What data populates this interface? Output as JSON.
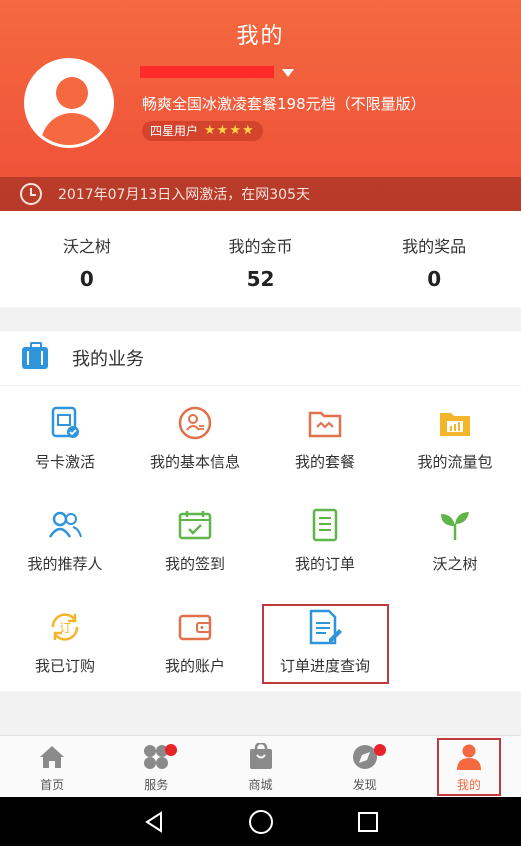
{
  "header": {
    "title": "我的",
    "plan": "畅爽全国冰激凌套餐198元档（不限量版）",
    "level": "四星用户",
    "stars": "★★★★",
    "activation": "2017年07月13日入网激活，在网305天"
  },
  "stats": [
    {
      "label": "沃之树",
      "value": "0"
    },
    {
      "label": "我的金币",
      "value": "52"
    },
    {
      "label": "我的奖品",
      "value": "0"
    }
  ],
  "services": {
    "title": "我的业务",
    "items": [
      {
        "label": "号卡激活",
        "icon": "sim-card-icon"
      },
      {
        "label": "我的基本信息",
        "icon": "profile-info-icon"
      },
      {
        "label": "我的套餐",
        "icon": "package-icon"
      },
      {
        "label": "我的流量包",
        "icon": "data-pack-icon"
      },
      {
        "label": "我的推荐人",
        "icon": "referrer-icon"
      },
      {
        "label": "我的签到",
        "icon": "check-in-icon"
      },
      {
        "label": "我的订单",
        "icon": "order-icon"
      },
      {
        "label": "沃之树",
        "icon": "tree-icon"
      },
      {
        "label": "我已订购",
        "icon": "subscribed-icon"
      },
      {
        "label": "我的账户",
        "icon": "wallet-icon"
      },
      {
        "label": "订单进度查询",
        "icon": "order-progress-icon"
      }
    ]
  },
  "tabs": [
    {
      "label": "首页",
      "icon": "home-icon"
    },
    {
      "label": "服务",
      "icon": "services-icon"
    },
    {
      "label": "商城",
      "icon": "shop-icon"
    },
    {
      "label": "发现",
      "icon": "discover-icon"
    },
    {
      "label": "我的",
      "icon": "me-icon"
    }
  ],
  "colors": {
    "accent": "#f4693f",
    "highlight": "#c0393b",
    "badge": "#e8232a"
  }
}
